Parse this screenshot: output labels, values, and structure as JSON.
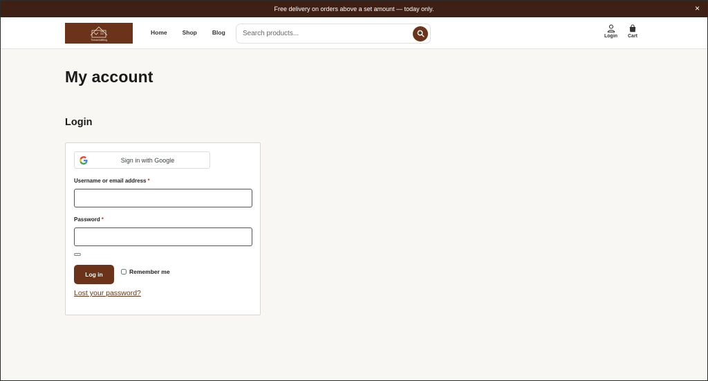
{
  "announcement": {
    "text": "Free delivery on orders above a set amount — today only.",
    "close_label": "×"
  },
  "header": {
    "logo_text": "Theramistifiting",
    "nav": [
      {
        "label": "Home"
      },
      {
        "label": "Shop"
      },
      {
        "label": "Blog"
      }
    ],
    "search": {
      "placeholder": "Search products..."
    },
    "login_label": "Login",
    "cart_label": "Cart"
  },
  "page": {
    "title": "My account",
    "section_title": "Login"
  },
  "form": {
    "google_button": "Sign in with Google",
    "username_label": "Username or email address",
    "password_label": "Password",
    "required_mark": "*",
    "username_value": "",
    "password_value": "",
    "login_button": "Log in",
    "remember_label": "Remember me",
    "lost_password": "Lost your password?"
  },
  "icons": {
    "search": "search-icon",
    "user": "user-icon",
    "cart": "bag-icon",
    "google": "google-icon",
    "close": "close-icon"
  },
  "colors": {
    "brand": "#6b3319",
    "topbar": "#3e2114",
    "background": "#f8f7f4"
  }
}
